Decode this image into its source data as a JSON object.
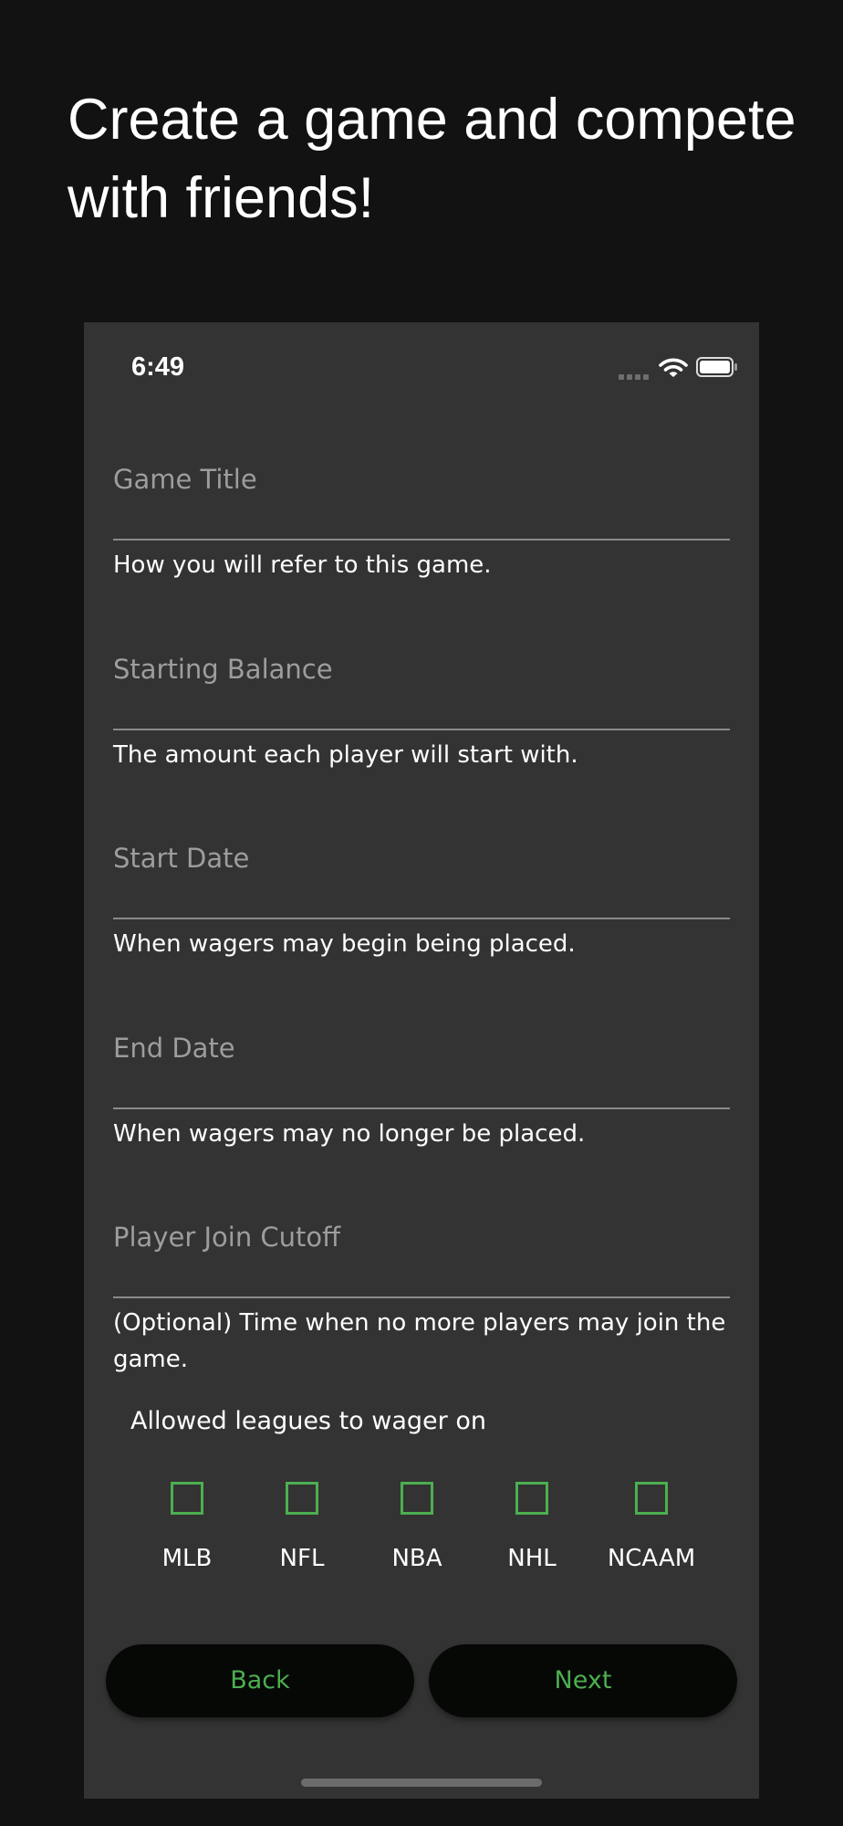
{
  "headline": "Create a game and compete\nwith friends!",
  "status_bar": {
    "time": "6:49",
    "icons": [
      "signal-icon",
      "wifi-icon",
      "battery-icon"
    ]
  },
  "fields": [
    {
      "label": "Game Title",
      "help": "How you will refer to this game."
    },
    {
      "label": "Starting Balance",
      "help": "The amount each player will start with."
    },
    {
      "label": "Start Date",
      "help": "When wagers may begin being placed."
    },
    {
      "label": "End Date",
      "help": "When wagers may no longer be placed."
    },
    {
      "label": "Player Join Cutoff",
      "help": "(Optional) Time when no more players may join the game."
    }
  ],
  "leagues": {
    "title": "Allowed leagues to wager on",
    "items": [
      {
        "label": "MLB",
        "checked": false
      },
      {
        "label": "NFL",
        "checked": false
      },
      {
        "label": "NBA",
        "checked": false
      },
      {
        "label": "NHL",
        "checked": false
      },
      {
        "label": "NCAAM",
        "checked": false
      }
    ]
  },
  "buttons": {
    "back": "Back",
    "next": "Next"
  },
  "colors": {
    "accent": "#4caf50",
    "page_background": "#121213",
    "screen_background": "#333333",
    "button_background": "#060806"
  }
}
